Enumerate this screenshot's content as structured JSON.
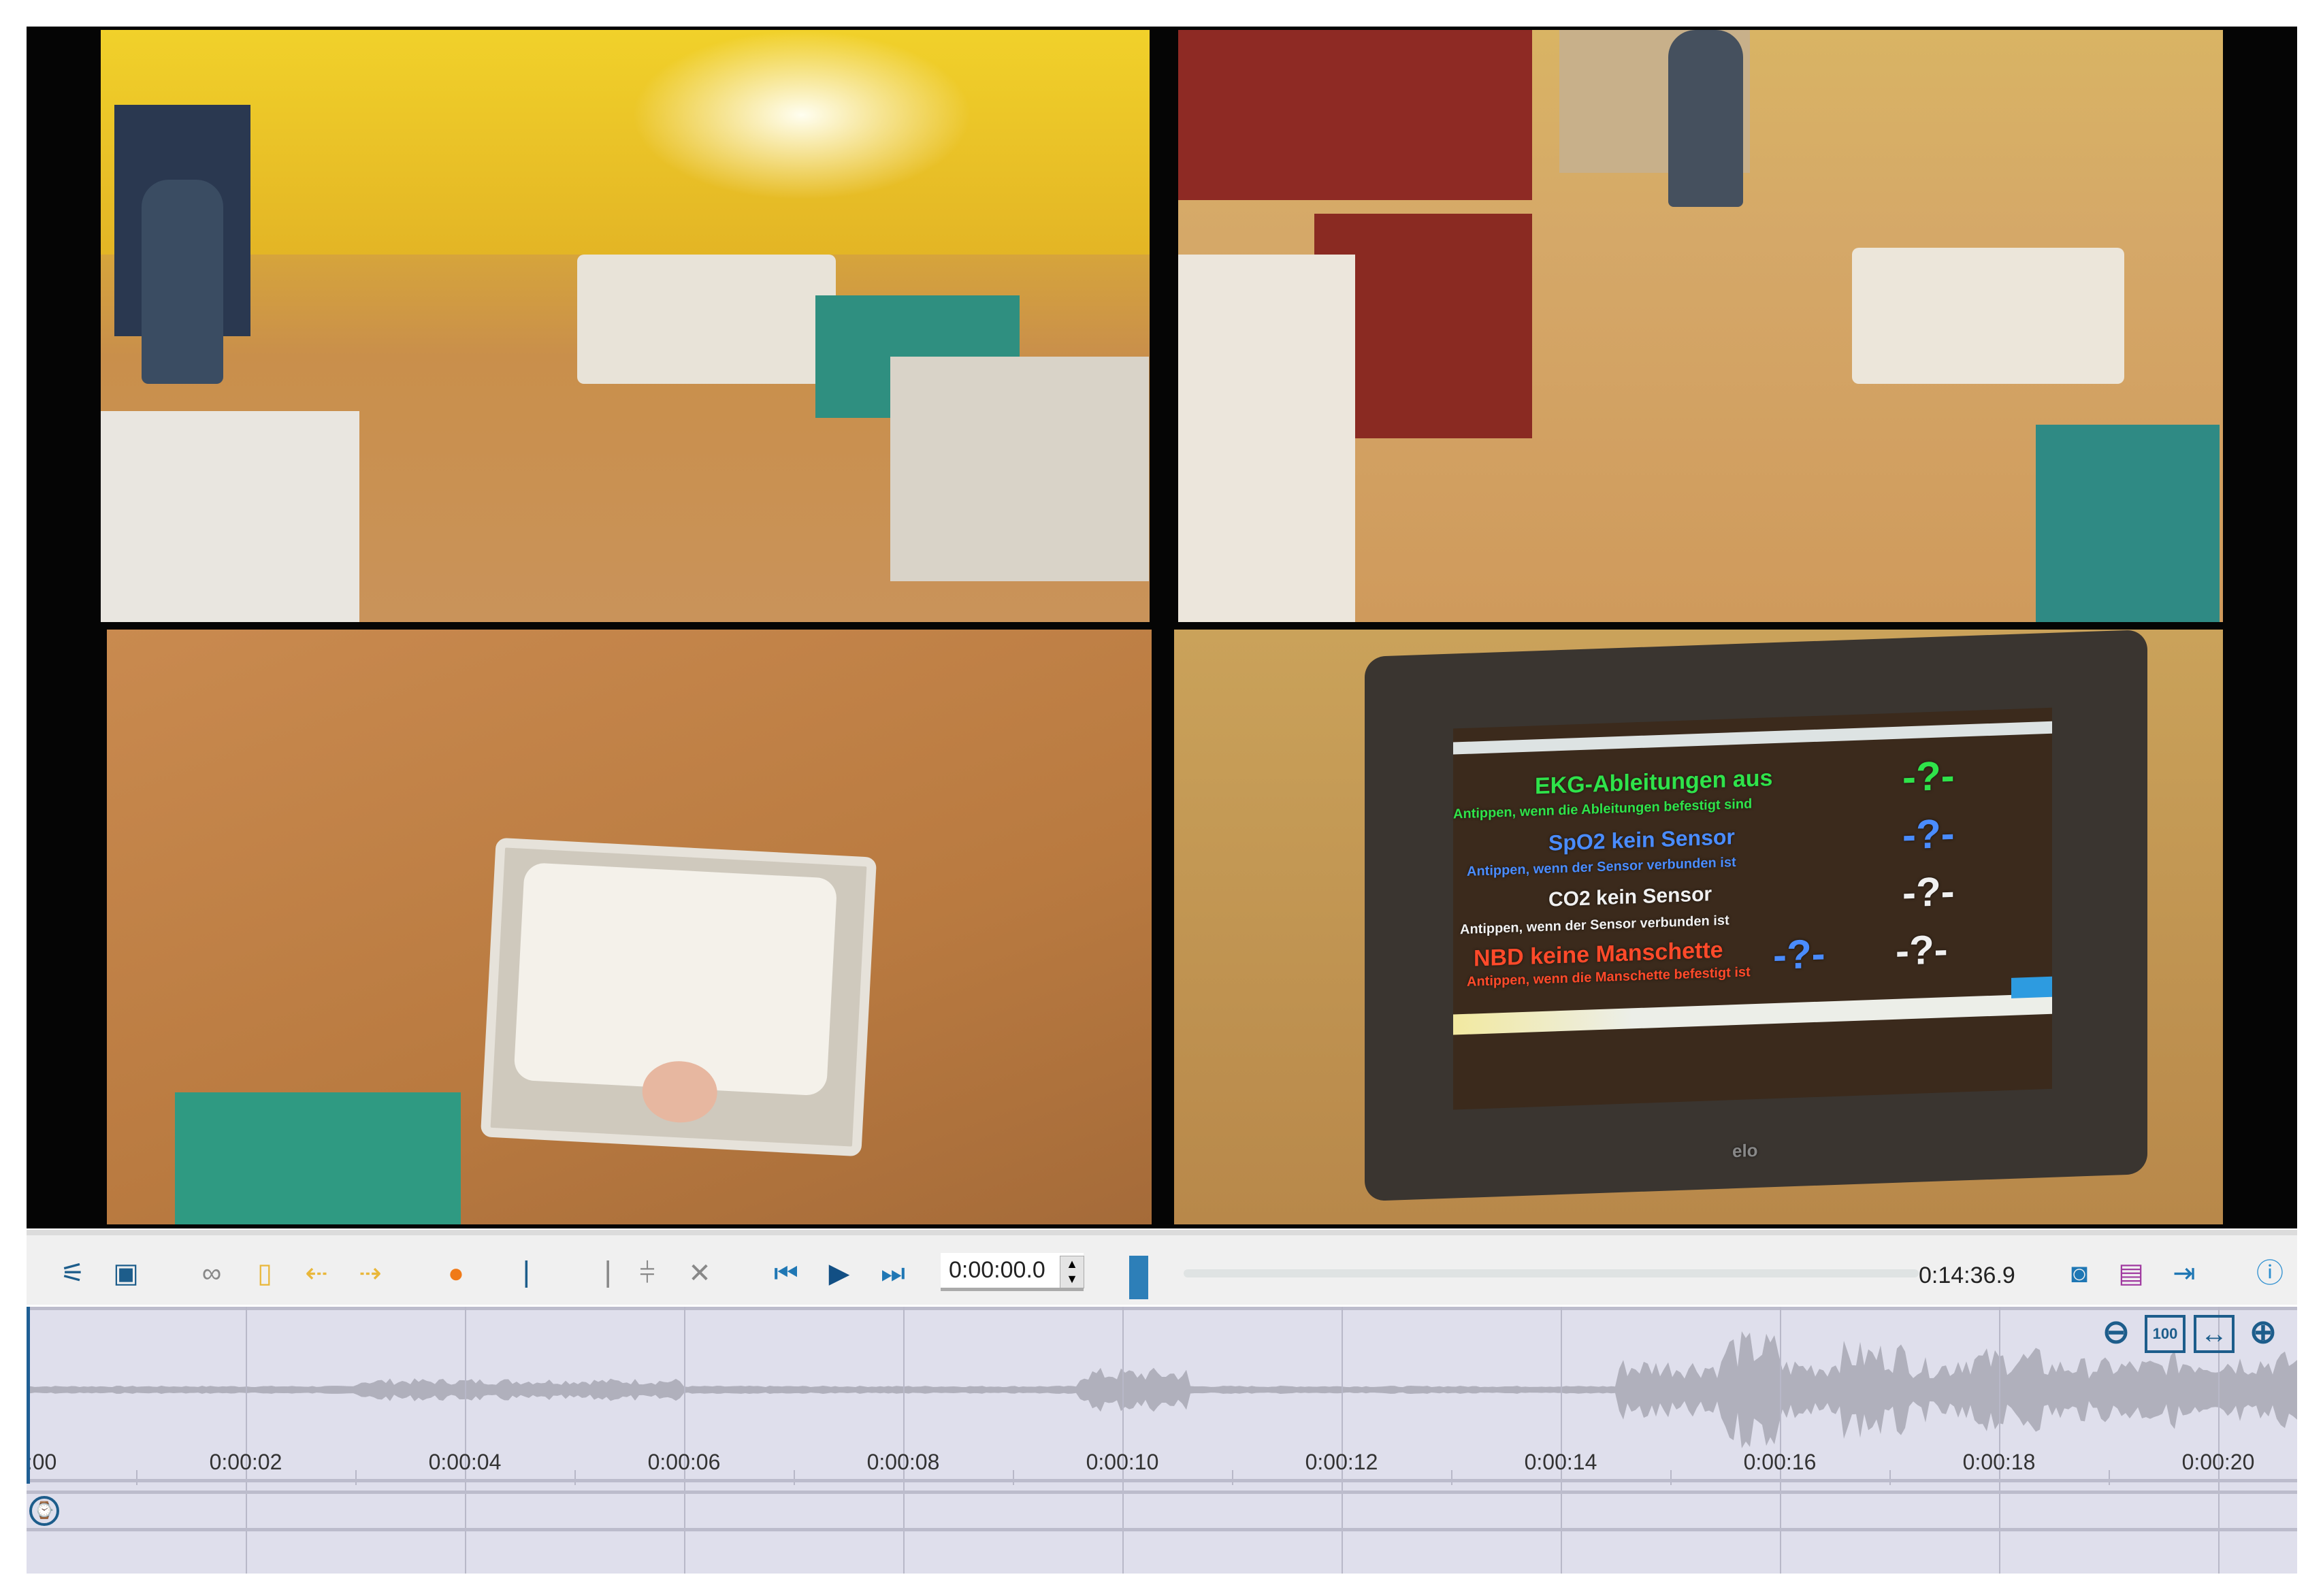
{
  "cameras": [
    {
      "name": "camera-1-room-overview"
    },
    {
      "name": "camera-2-room-entrance"
    },
    {
      "name": "camera-3-incubator-top"
    },
    {
      "name": "camera-4-monitor"
    }
  ],
  "monitor_screen": {
    "lines": [
      {
        "text": "EKG-Ableitungen aus",
        "color": "#2fe34a"
      },
      {
        "text": "Antippen, wenn die Ableitungen befestigt sind",
        "color": "#2fe34a"
      },
      {
        "text": "SpO2 kein Sensor",
        "color": "#4a8cff"
      },
      {
        "text": "Antippen, wenn der Sensor verbunden ist",
        "color": "#4a8cff"
      },
      {
        "text": "CO2 kein Sensor",
        "color": "#f0f0f0"
      },
      {
        "text": "Antippen, wenn der Sensor verbunden ist",
        "color": "#f0f0f0"
      },
      {
        "text": "NBD keine Manschette",
        "color": "#ff4a2a"
      },
      {
        "text": "Antippen, wenn die Manschette befestigt ist",
        "color": "#ff4a2a"
      }
    ],
    "values": [
      "-?-",
      "-?-",
      "-?-",
      "-?-",
      "-?-"
    ],
    "brand": "elo"
  },
  "toolbar": {
    "current_time": "0:00:00.0",
    "total_time": "0:14:36.9",
    "progress": 0.0,
    "icons": [
      "settings-sliders-icon",
      "video-view-icon",
      "link-icon",
      "add-marker-icon",
      "marker-previous-icon",
      "marker-next-icon",
      "comment-icon",
      "set-in-point-icon",
      "set-out-point-icon",
      "split-icon",
      "remove-segment-icon",
      "skip-to-start-icon",
      "play-icon",
      "skip-to-end-icon",
      "snapshot-camera-icon",
      "export-image-icon",
      "export-file-icon",
      "info-icon"
    ]
  },
  "timeline": {
    "labels": [
      ":00",
      "0:00:02",
      "0:00:04",
      "0:00:06",
      "0:00:08",
      "0:00:10",
      "0:00:12",
      "0:00:14",
      "0:00:16",
      "0:00:18",
      "0:00:20"
    ],
    "zoom_icons": [
      "zoom-out-icon",
      "zoom-100-icon",
      "fit-width-icon",
      "zoom-in-icon"
    ],
    "zoom_100_label": "100"
  },
  "colors": {
    "accent": "#1f6fa8",
    "timeline_bg": "#dfdfec",
    "toolbar_bg": "#f0f0f0",
    "waveform": "#b0b0bc"
  }
}
